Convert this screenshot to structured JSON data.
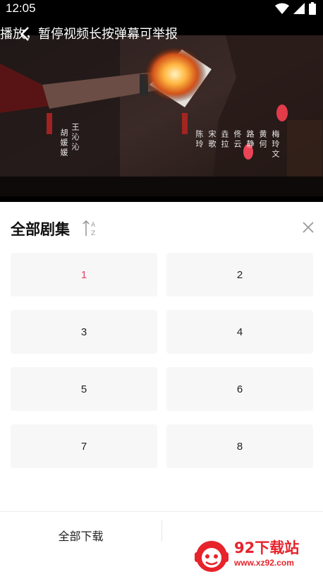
{
  "status_bar": {
    "time": "12:05",
    "icons": [
      "wifi-icon",
      "signal-icon",
      "battery-icon"
    ]
  },
  "video": {
    "marquee": "播放，暂停视频长按弹幕可举报",
    "credits": [
      "王沁沁",
      "胡媛媛",
      "陈玲",
      "宋歌",
      "垚拉",
      "佟云",
      "路静",
      "黄何",
      "梅玲文"
    ]
  },
  "panel": {
    "title": "全部剧集",
    "sort_icon": "sort-az-icon",
    "close_icon": "close-icon"
  },
  "episodes": [
    "1",
    "2",
    "3",
    "4",
    "5",
    "6",
    "7",
    "8"
  ],
  "active_episode": "1",
  "footer": {
    "download_all": "全部下载"
  },
  "watermark": {
    "name": "92下载站",
    "url": "www.xz92.com"
  },
  "colors": {
    "accent": "#e8406c",
    "watermark_red": "#e7232b",
    "tile_bg": "#f7f7f7"
  }
}
